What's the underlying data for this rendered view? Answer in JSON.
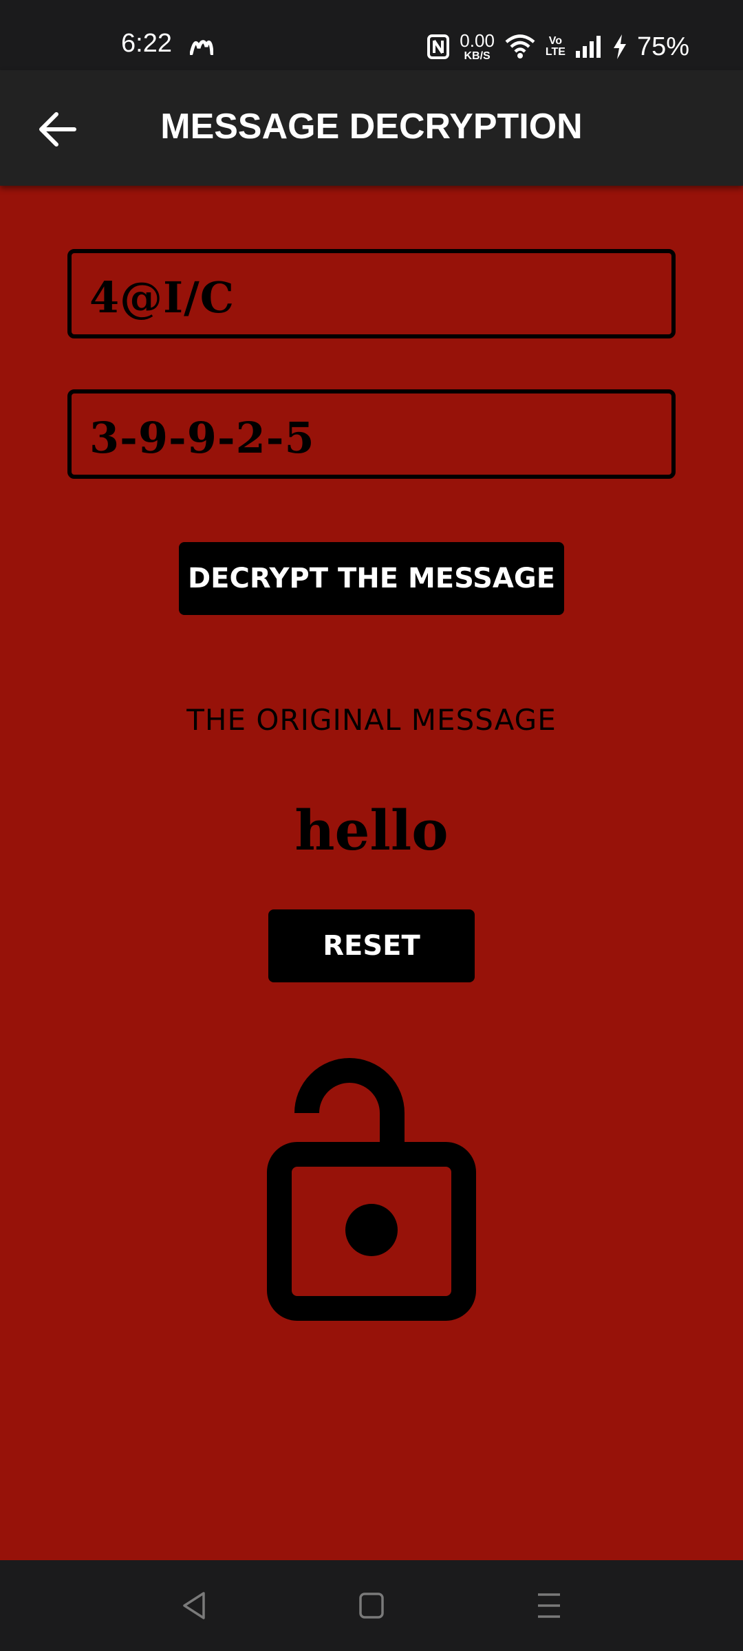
{
  "status_bar": {
    "time": "6:22",
    "net_speed_value": "0.00",
    "net_speed_unit": "KB/S",
    "volte_top": "Vo",
    "volte_bottom": "LTE",
    "battery": "75%"
  },
  "app_bar": {
    "title": "MESSAGE DECRYPTION",
    "background": "#222222"
  },
  "form": {
    "cipher_value": "4@I/C",
    "key_value": "3-9-9-2-5",
    "decrypt_label": "DECRYPT THE MESSAGE"
  },
  "result": {
    "heading": "THE ORIGINAL MESSAGE",
    "message": "hello",
    "reset_label": "RESET"
  },
  "colors": {
    "page_background": "#971209",
    "button_background": "#000000",
    "system_bar": "#1b1b1c"
  },
  "icons": [
    "back-arrow-icon",
    "unlock-icon",
    "nav-back-icon",
    "nav-home-icon",
    "nav-recents-icon"
  ]
}
